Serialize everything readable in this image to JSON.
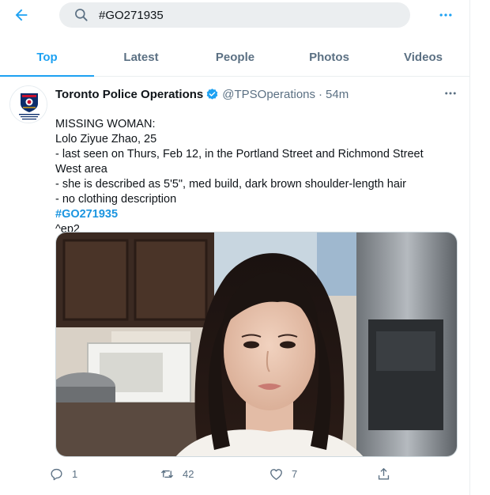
{
  "header": {
    "back_icon": "arrow-left-icon",
    "search_query": "#GO271935",
    "search_icon": "search-icon",
    "more_icon": "more-horizontal-icon"
  },
  "tabs": [
    {
      "label": "Top",
      "active": true
    },
    {
      "label": "Latest",
      "active": false
    },
    {
      "label": "People",
      "active": false
    },
    {
      "label": "Photos",
      "active": false
    },
    {
      "label": "Videos",
      "active": false
    }
  ],
  "tweet": {
    "display_name": "Toronto Police Operations",
    "verified": true,
    "handle": "@TPSOperations",
    "separator": "·",
    "time": "54m",
    "body": {
      "line1": "MISSING WOMAN:",
      "line2": "Lolo Ziyue Zhao, 25",
      "line3": "- last seen on Thurs, Feb 12, in the Portland Street and Richmond Street West area",
      "line4": "- she is described as 5'5\", med build, dark brown shoulder-length hair",
      "line5": "- no clothing description",
      "hashtag": "#GO271935",
      "line7": "^ep2"
    },
    "actions": {
      "replies": "1",
      "retweets": "42",
      "likes": "7"
    }
  },
  "colors": {
    "accent": "#1da1f2",
    "secondary_text": "#5b7083",
    "primary_text": "#0f1419",
    "search_bg": "#ebeef0"
  }
}
